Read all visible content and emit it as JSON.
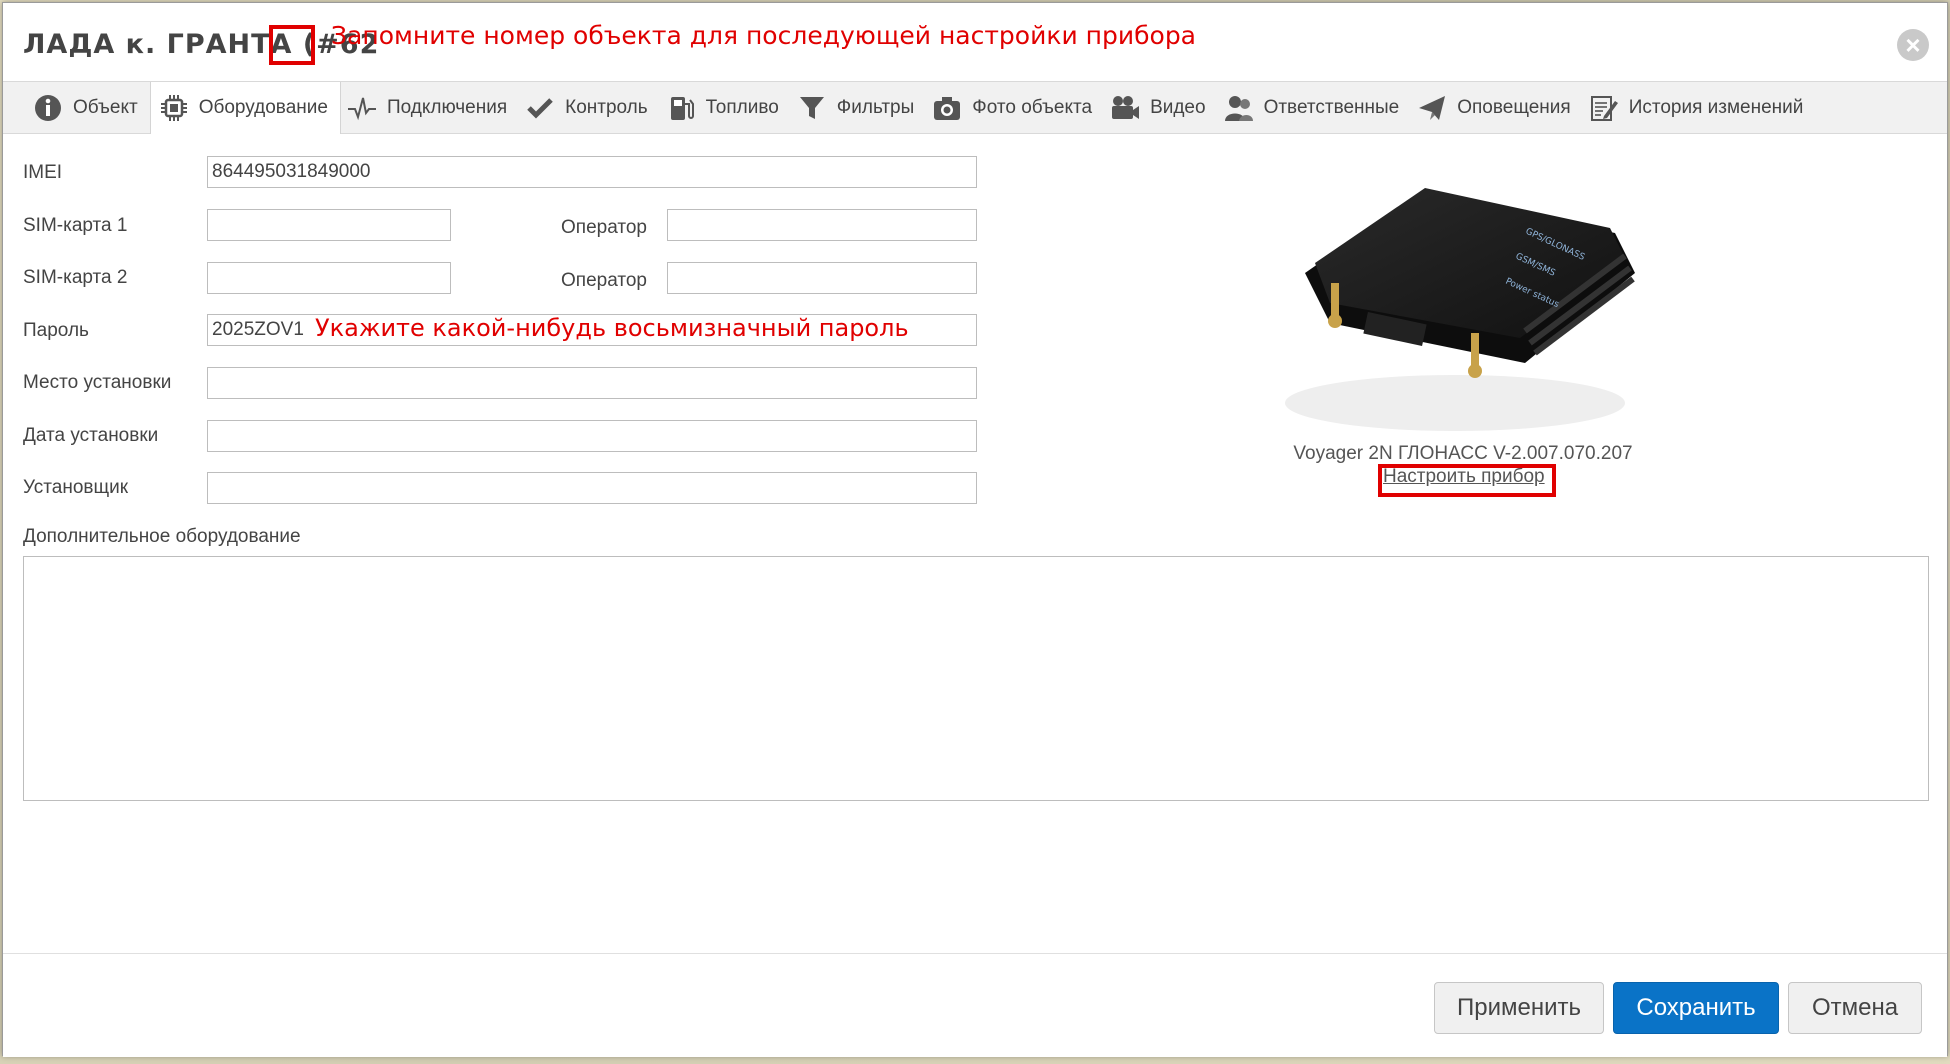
{
  "dialog": {
    "title": "ЛАДА к. ГРАНТА (#62",
    "annotation": "Запомните номер объекта для последующей настройки прибора",
    "close_symbol": "×"
  },
  "tabs": [
    {
      "label": "Объект",
      "icon": "info-icon"
    },
    {
      "label": "Оборудование",
      "icon": "chip-icon",
      "active": true
    },
    {
      "label": "Подключения",
      "icon": "pulse-icon"
    },
    {
      "label": "Контроль",
      "icon": "checkmark-icon"
    },
    {
      "label": "Топливо",
      "icon": "fuel-pump-icon"
    },
    {
      "label": "Фильтры",
      "icon": "filter-icon"
    },
    {
      "label": "Фото объекта",
      "icon": "camera-icon"
    },
    {
      "label": "Видео",
      "icon": "video-camera-icon"
    },
    {
      "label": "Ответственные",
      "icon": "users-icon"
    },
    {
      "label": "Оповещения",
      "icon": "paper-plane-icon"
    },
    {
      "label": "История изменений",
      "icon": "edit-history-icon"
    }
  ],
  "form": {
    "imei_label": "IMEI",
    "imei_value": "864495031849000",
    "sim1_label": "SIM-карта 1",
    "sim1_value": "",
    "sim2_label": "SIM-карта 2",
    "sim2_value": "",
    "operator_label": "Оператор",
    "operator1_value": "",
    "operator2_value": "",
    "password_label": "Пароль",
    "password_value": "2025ZOV1",
    "password_annotation": "Укажите какой-нибудь восьмизначный пароль",
    "install_place_label": "Место установки",
    "install_place_value": "",
    "install_date_label": "Дата установки",
    "install_date_value": "",
    "installer_label": "Установщик",
    "installer_value": "",
    "extra_label": "Дополнительное оборудование",
    "extra_value": ""
  },
  "device": {
    "caption": "Voyager 2N ГЛОНАСС  V-2.007.070.207",
    "configure_link": "Настроить прибор",
    "label_lines": [
      "GPS/GLONASS",
      "GSM/SMS",
      "Power status"
    ]
  },
  "footer": {
    "apply_label": "Применить",
    "save_label": "Сохранить",
    "cancel_label": "Отмена"
  },
  "colors": {
    "accent": "#0a73c7",
    "annotation": "#e00000"
  }
}
